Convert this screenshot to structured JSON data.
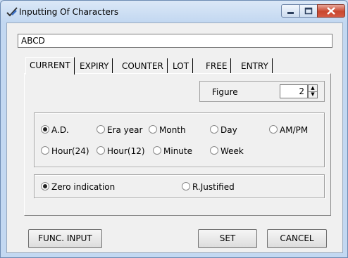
{
  "window": {
    "title": "Inputting Of Characters",
    "icon": "checkmark-pen-icon",
    "controls": {
      "minimize": "minimize-icon",
      "maximize": "maximize-icon",
      "close": "close-icon"
    }
  },
  "text_field": {
    "value": "ABCD"
  },
  "tabs": [
    {
      "label": "CURRENT",
      "active": true
    },
    {
      "label": "EXPIRY",
      "active": false
    },
    {
      "label": "COUNTER",
      "active": false
    },
    {
      "label": "LOT",
      "active": false
    },
    {
      "label": "FREE",
      "active": false
    },
    {
      "label": "ENTRY",
      "active": false
    }
  ],
  "figure": {
    "label": "Figure",
    "value": "2"
  },
  "format_options": {
    "row1": [
      "A.D.",
      "Era year",
      "Month",
      "Day",
      "AM/PM"
    ],
    "row2": [
      "Hour(24)",
      "Hour(12)",
      "Minute",
      "Week"
    ],
    "selected": "A.D."
  },
  "justify_options": {
    "items": [
      "Zero indication",
      "R.Justified"
    ],
    "selected": "Zero indication"
  },
  "buttons": {
    "func_input": "FUNC. INPUT",
    "set": "SET",
    "cancel": "CANCEL"
  }
}
